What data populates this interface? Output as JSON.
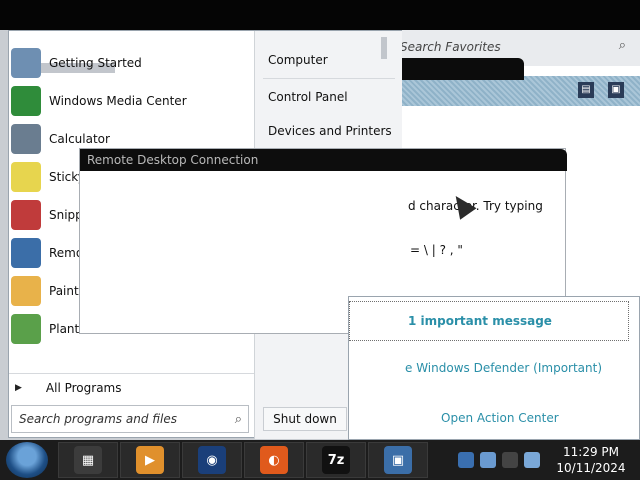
{
  "favorites": {
    "search_placeholder": "Search Favorites"
  },
  "start_menu": {
    "programs": [
      {
        "label": "Getting Started",
        "icon": "getting-started-icon",
        "color": "#6e8fb2"
      },
      {
        "label": "Windows Media Center",
        "icon": "windows-media-center-icon",
        "color": "#2f8c3a"
      },
      {
        "label": "Calculator",
        "icon": "calculator-icon",
        "color": "#6a7d90"
      },
      {
        "label": "Sticky Notes",
        "icon": "sticky-notes-icon",
        "color": "#e7d54e"
      },
      {
        "label": "Snipping Tool",
        "icon": "snipping-tool-icon",
        "color": "#c03b3b"
      },
      {
        "label": "Remote Desktop Connection",
        "icon": "remote-desktop-icon",
        "color": "#3b6ea8"
      },
      {
        "label": "Paint",
        "icon": "paint-icon",
        "color": "#e8b24a"
      },
      {
        "label": "Plants",
        "icon": "plants-icon",
        "color": "#5aa04a"
      }
    ],
    "all_programs": "All Programs",
    "search_placeholder": "Search programs and files",
    "right_items": [
      "Computer",
      "Control Panel",
      "Devices and Printers"
    ],
    "shutdown_label": "Shut down"
  },
  "rdc_window": {
    "title": "Remote Desktop Connection",
    "text_line1": "d character. Try typing",
    "text_line2": "= \\ | ? , \""
  },
  "action_center": {
    "message": "1 important message",
    "item": "e Windows Defender (Important)",
    "link": "Open Action Center"
  },
  "taskbar": {
    "buttons": [
      {
        "name": "taskbar-media-app",
        "glyph": "▦",
        "color": "#3c3c3c"
      },
      {
        "name": "taskbar-media-player",
        "glyph": "▶",
        "color": "#e0902c"
      },
      {
        "name": "taskbar-globe",
        "glyph": "◉",
        "color": "#1a3f7a"
      },
      {
        "name": "taskbar-firefox",
        "glyph": "◐",
        "color": "#e05a1c"
      },
      {
        "name": "taskbar-7zip",
        "glyph": "7z",
        "color": "#111111"
      },
      {
        "name": "taskbar-remote-desktop",
        "glyph": "▣",
        "color": "#3b6ea8"
      }
    ],
    "time": "11:29 PM",
    "date": "10/11/2024"
  }
}
